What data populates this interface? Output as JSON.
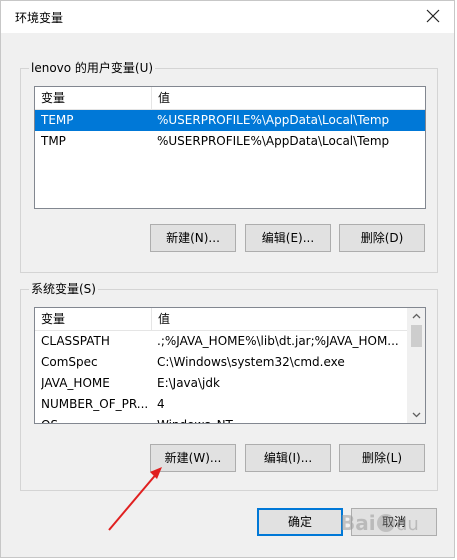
{
  "window": {
    "title": "环境变量"
  },
  "user_vars": {
    "legend": "lenovo 的用户变量(U)",
    "columns": [
      "变量",
      "值"
    ],
    "rows": [
      {
        "name": "TEMP",
        "value": "%USERPROFILE%\\AppData\\Local\\Temp",
        "selected": true
      },
      {
        "name": "TMP",
        "value": "%USERPROFILE%\\AppData\\Local\\Temp",
        "selected": false
      }
    ],
    "buttons": {
      "new": "新建(N)...",
      "edit": "编辑(E)...",
      "delete": "删除(D)"
    }
  },
  "system_vars": {
    "legend": "系统变量(S)",
    "columns": [
      "变量",
      "值"
    ],
    "rows": [
      {
        "name": "CLASSPATH",
        "value": ".;%JAVA_HOME%\\lib\\dt.jar;%JAVA_HOM...",
        "selected": false
      },
      {
        "name": "ComSpec",
        "value": "C:\\Windows\\system32\\cmd.exe",
        "selected": false
      },
      {
        "name": "JAVA_HOME",
        "value": "E:\\Java\\jdk",
        "selected": false
      },
      {
        "name": "NUMBER_OF_PR...",
        "value": "4",
        "selected": false
      },
      {
        "name": "OS",
        "value": "Windows_NT",
        "selected": false
      }
    ],
    "buttons": {
      "new": "新建(W)...",
      "edit": "编辑(I)...",
      "delete": "删除(L)"
    }
  },
  "footer": {
    "ok": "确定",
    "cancel": "取消"
  },
  "colors": {
    "selection": "#0078d7",
    "annotation_arrow": "#e02020"
  },
  "icons": [
    "close-icon",
    "scroll-up-icon",
    "scroll-down-icon",
    "annotation-arrow",
    "baidu-watermark"
  ]
}
